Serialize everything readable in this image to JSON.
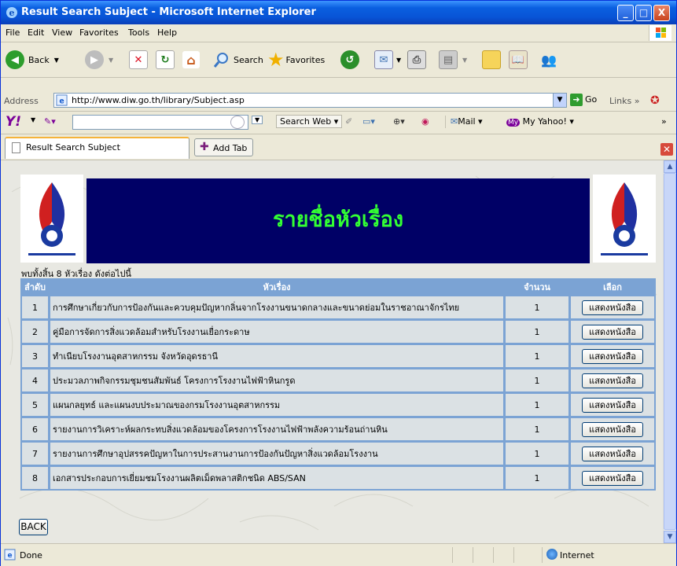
{
  "window": {
    "title": "Result Search Subject - Microsoft Internet Explorer",
    "buttons": {
      "minimize": "_",
      "maximize": "□",
      "close": "X"
    }
  },
  "menu": [
    "File",
    "Edit",
    "View",
    "Favorites",
    "Tools",
    "Help"
  ],
  "toolbar": {
    "back_label": "Back",
    "search_label": "Search",
    "favorites_label": "Favorites"
  },
  "address": {
    "label": "Address",
    "url": "http://www.diw.go.th/library/Subject.asp",
    "go_label": "Go",
    "links_label": "Links"
  },
  "yahoo": {
    "logo": "Y!",
    "search_web_label": "Search Web",
    "mail_label": "Mail",
    "my_yahoo_label": "My Yahoo!"
  },
  "tabs": {
    "active_label": "Result Search Subject",
    "add_tab_label": "Add Tab"
  },
  "page": {
    "banner_title": "รายชื่อหัวเรื่อง",
    "found_text": "พบทั้งสิ้น 8 หัวเรื่อง ดังต่อไปนี้",
    "columns": [
      "ลำดับ",
      "หัวเรื่อง",
      "จำนวน",
      "เลือก"
    ],
    "rows": [
      {
        "no": "1",
        "subject": "การศึกษาเกี่ยวกับการป้องกันและควบคุมปัญหากลิ่นจากโรงงานขนาดกลางและขนาดย่อมในราชอาณาจักรไทย",
        "count": "1",
        "action": "แสดงหนังสือ"
      },
      {
        "no": "2",
        "subject": "คู่มือการจัดการสิ่งแวดล้อมสำหรับโรงงานเยื่อกระดาษ",
        "count": "1",
        "action": "แสดงหนังสือ"
      },
      {
        "no": "3",
        "subject": "ทำเนียบโรงงานอุตสาหกรรม จังหวัดอุดรธานี",
        "count": "1",
        "action": "แสดงหนังสือ"
      },
      {
        "no": "4",
        "subject": "ประมวลภาพกิจกรรมชุมชนสัมพันธ์ โครงการโรงงานไฟฟ้าหินกรูด",
        "count": "1",
        "action": "แสดงหนังสือ"
      },
      {
        "no": "5",
        "subject": "แผนกลยุทธ์ และแผนงบประมาณของกรมโรงงานอุตสาหกรรม",
        "count": "1",
        "action": "แสดงหนังสือ"
      },
      {
        "no": "6",
        "subject": "รายงานการวิเคราะห์ผลกระทบสิ่งแวดล้อมของโครงการโรงงานไฟฟ้าพลังความร้อนถ่านหิน",
        "count": "1",
        "action": "แสดงหนังสือ"
      },
      {
        "no": "7",
        "subject": "รายงานการศึกษาอุปสรรคปัญหาในการประสานงานการป้องกันปัญหาสิ่งแวดล้อมโรงงาน",
        "count": "1",
        "action": "แสดงหนังสือ"
      },
      {
        "no": "8",
        "subject": "เอกสารประกอบการเยี่ยมชมโรงงานผลิตเม็ดพลาสติกชนิด ABS/SAN",
        "count": "1",
        "action": "แสดงหนังสือ"
      }
    ],
    "back_label": "BACK"
  },
  "status": {
    "text": "Done",
    "zone": "Internet"
  },
  "colors": {
    "banner_bg": "#000066",
    "banner_text": "#33ff33",
    "table_header": "#7ba3d4",
    "xp_blue": "#0854d6"
  }
}
